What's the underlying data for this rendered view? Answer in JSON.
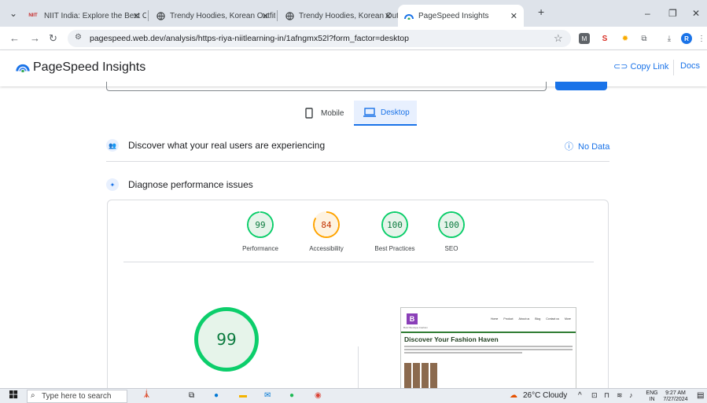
{
  "browser": {
    "tabs": [
      {
        "label": "NIIT India: Explore the Best Onl",
        "favicon": "niit-icon",
        "favicon_text": "NIIT"
      },
      {
        "label": "Trendy Hoodies, Korean Outfits",
        "favicon": "globe-icon"
      },
      {
        "label": "Trendy Hoodies, Korean Outfits",
        "favicon": "globe-icon"
      },
      {
        "label": "PageSpeed Insights",
        "favicon": "pagespeed-icon"
      }
    ],
    "url": "pagespeed.web.dev/analysis/https-riya-niitlearning-in/1afngmx52l?form_factor=desktop",
    "profile_initial": "R"
  },
  "header": {
    "title": "PageSpeed Insights",
    "copy_link": "Copy Link",
    "docs": "Docs",
    "accent": "#1a73e8"
  },
  "device_tabs": {
    "mobile": "Mobile",
    "desktop": "Desktop",
    "selected": "desktop"
  },
  "sections": {
    "real_users": "Discover what your real users are experiencing",
    "no_data": "No Data",
    "diagnose": "Diagnose performance issues"
  },
  "scores": [
    {
      "value": "99",
      "label": "Performance",
      "color": "#0cce6b",
      "fraction": 0.99
    },
    {
      "value": "84",
      "label": "Accessibility",
      "color": "#ffa400",
      "fraction": 0.84
    },
    {
      "value": "100",
      "label": "Best Practices",
      "color": "#0cce6b",
      "fraction": 1.0
    },
    {
      "value": "100",
      "label": "SEO",
      "color": "#0cce6b",
      "fraction": 1.0
    }
  ],
  "main_score": {
    "value": "99",
    "fraction": 0.99
  },
  "screenshot_preview": {
    "brand_letter": "B",
    "brand_sub": "Buzz Boutique Fashion",
    "nav": [
      "Home",
      "Product",
      "About us",
      "Blog",
      "Contact us",
      "More"
    ],
    "headline": "Discover Your Fashion Haven"
  },
  "taskbar": {
    "search_placeholder": "Type here to search",
    "weather": "26°C  Cloudy",
    "lang_top": "ENG",
    "lang_bottom": "IN",
    "time": "9:27 AM",
    "date": "7/27/2024"
  }
}
